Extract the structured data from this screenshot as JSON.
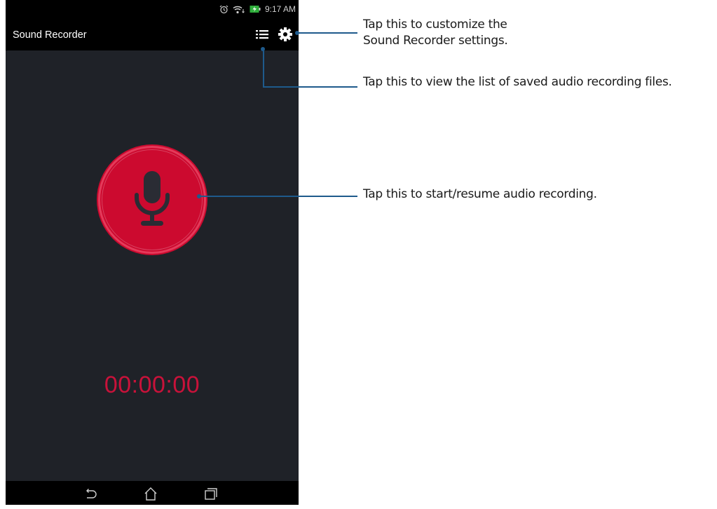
{
  "status_bar": {
    "time": "9:17 AM",
    "icons": [
      "alarm-icon",
      "wifi-icon",
      "battery-charging-icon"
    ]
  },
  "app_bar": {
    "title": "Sound Recorder",
    "actions": [
      "list-icon",
      "gear-icon"
    ]
  },
  "recorder": {
    "timer": "00:00:00",
    "record_button_icon": "microphone-icon",
    "accent_color": "#cc0a2f",
    "timer_color": "#c8123a"
  },
  "nav_bar": {
    "buttons": [
      "back-icon",
      "home-icon",
      "recent-apps-icon"
    ]
  },
  "callouts": {
    "settings_line1": "Tap this to customize the",
    "settings_line2": "Sound Recorder settings.",
    "list": "Tap this to view the list of saved audio recording files.",
    "record": "Tap this to start/resume audio recording."
  },
  "colors": {
    "screen_bg": "#1f2228",
    "bar_bg": "#000000",
    "callout_line": "#1e5a8c"
  }
}
